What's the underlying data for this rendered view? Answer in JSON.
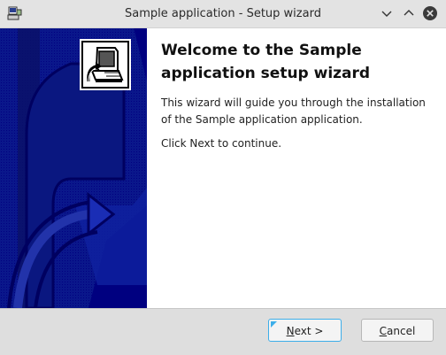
{
  "window": {
    "title": "Sample application - Setup wizard",
    "icon": "installer-app-icon",
    "controls": [
      "minimize",
      "maximize",
      "close"
    ]
  },
  "side_panel": {
    "background_color": "#000080",
    "logo_icon": "computer-install-icon"
  },
  "welcome": {
    "heading": "Welcome to the Sample application setup wizard",
    "body": "This wizard will guide you through the installation of the Sample application application.",
    "instruction": "Click Next to continue."
  },
  "buttons": {
    "next": {
      "mnemonic": "N",
      "rest": "ext >"
    },
    "cancel": {
      "mnemonic": "C",
      "rest": "ancel"
    }
  },
  "colors": {
    "accent": "#3daee9",
    "panel": "#000080"
  }
}
